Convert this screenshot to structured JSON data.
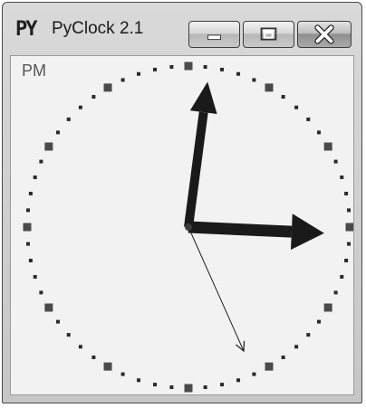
{
  "window": {
    "title": "PyClock 2.1",
    "icon_text": "PY"
  },
  "controls": {
    "minimize": "minimize",
    "maximize": "maximize",
    "close": "close"
  },
  "clock": {
    "ampm": "PM",
    "time": {
      "hour": 12,
      "minute": 15,
      "second": 26
    },
    "tick_marks": 60,
    "major_marks": 12,
    "hand_color": "#1a1a1a",
    "face_color": "#f2f2f2"
  }
}
